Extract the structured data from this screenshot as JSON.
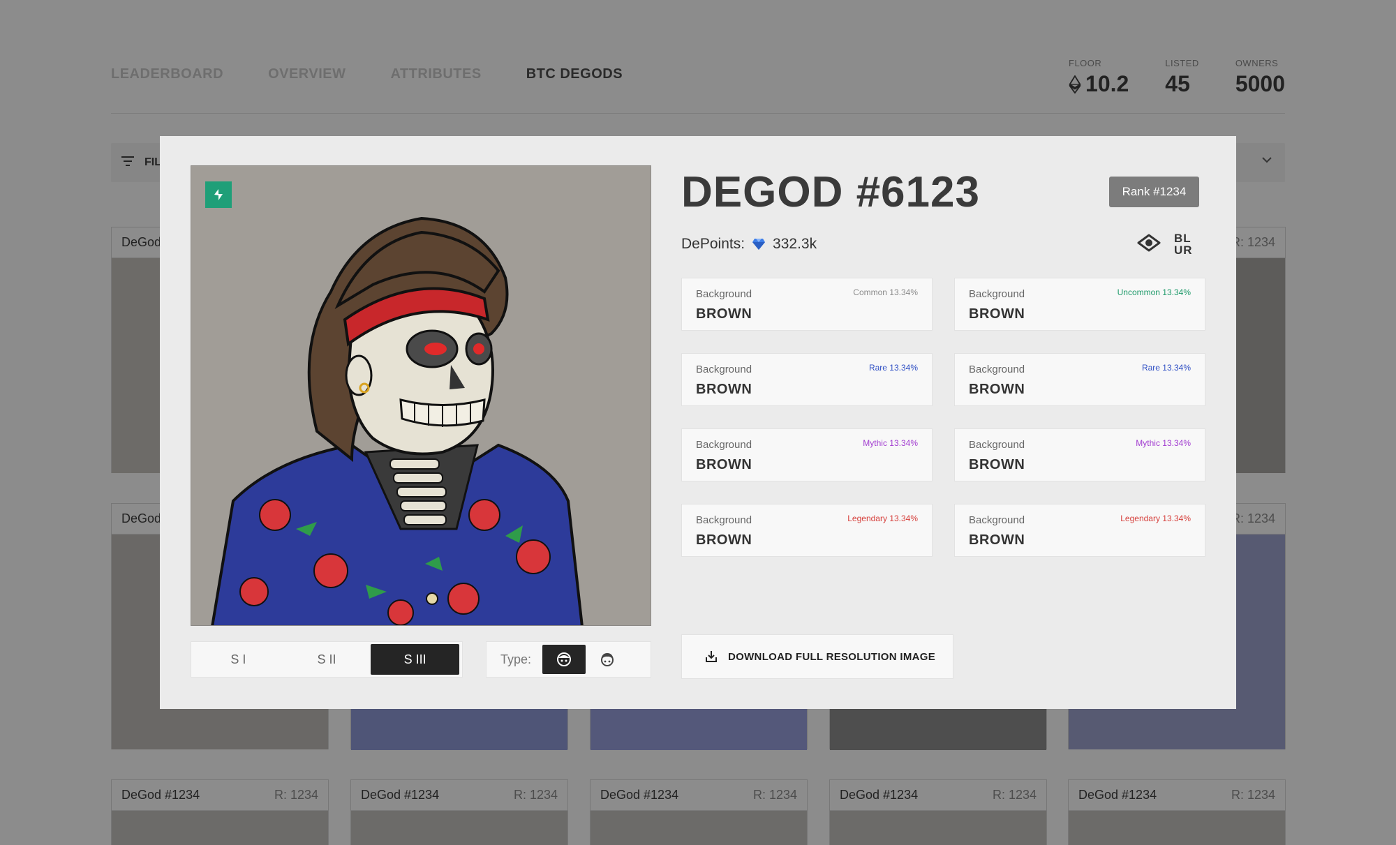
{
  "nav": {
    "tabs": [
      {
        "label": "LEADERBOARD"
      },
      {
        "label": "OVERVIEW"
      },
      {
        "label": "ATTRIBUTES"
      },
      {
        "label": "BTC DEGODS"
      }
    ]
  },
  "stats": {
    "floor_label": "FLOOR",
    "floor_value": "10.2",
    "listed_label": "LISTED",
    "listed_value": "45",
    "owners_label": "OWNERS",
    "owners_value": "5000"
  },
  "filter": {
    "label": "FIL"
  },
  "background_cards": {
    "top_rows_name": "DeGod",
    "top_rows_rank": "R: 1234",
    "bottom_row": [
      {
        "name": "DeGod #1234",
        "rank": "R: 1234"
      },
      {
        "name": "DeGod #1234",
        "rank": "R: 1234"
      },
      {
        "name": "DeGod #1234",
        "rank": "R: 1234"
      },
      {
        "name": "DeGod #1234",
        "rank": "R: 1234"
      },
      {
        "name": "DeGod #1234",
        "rank": "R: 1234"
      }
    ]
  },
  "modal": {
    "title": "DEGOD #6123",
    "rank": "Rank #1234",
    "depoints_label": "DePoints:",
    "depoints_value": "332.3k",
    "blur_logo": "BL UR",
    "seasons": [
      "S I",
      "S II",
      "S III"
    ],
    "type_label": "Type:",
    "download_label": "DOWNLOAD FULL RESOLUTION IMAGE",
    "traits": [
      {
        "key": "Background",
        "value": "BROWN",
        "rarity": "Common 13.34%",
        "color": "#8a8a8a"
      },
      {
        "key": "Background",
        "value": "BROWN",
        "rarity": "Uncommon 13.34%",
        "color": "#1e9a6a"
      },
      {
        "key": "Background",
        "value": "BROWN",
        "rarity": "Rare 13.34%",
        "color": "#2f4fc4"
      },
      {
        "key": "Background",
        "value": "BROWN",
        "rarity": "Rare 13.34%",
        "color": "#2f4fc4"
      },
      {
        "key": "Background",
        "value": "BROWN",
        "rarity": "Mythic 13.34%",
        "color": "#a13bd0"
      },
      {
        "key": "Background",
        "value": "BROWN",
        "rarity": "Mythic 13.34%",
        "color": "#a13bd0"
      },
      {
        "key": "Background",
        "value": "BROWN",
        "rarity": "Legendary 13.34%",
        "color": "#d6403c"
      },
      {
        "key": "Background",
        "value": "BROWN",
        "rarity": "Legendary 13.34%",
        "color": "#d6403c"
      }
    ]
  }
}
